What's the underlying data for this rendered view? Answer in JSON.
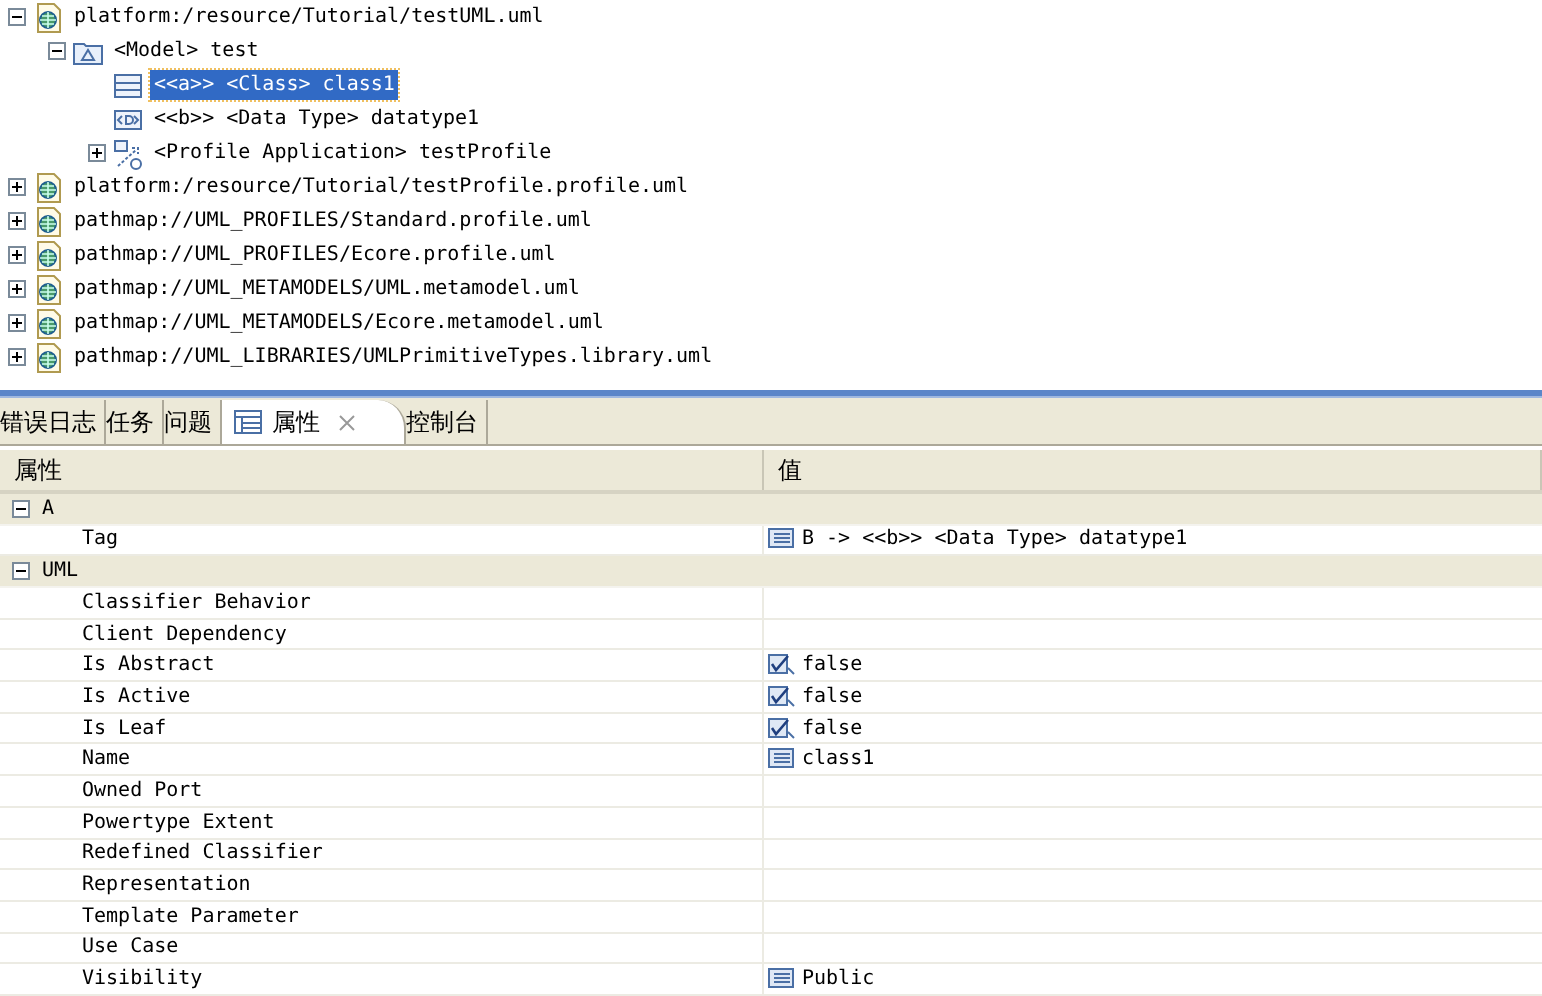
{
  "tree": [
    {
      "label": "platform:/resource/Tutorial/testUML.uml",
      "kind": "resource",
      "expanded": true,
      "selected": false,
      "children": [
        {
          "label": "<Model> test",
          "kind": "model",
          "expanded": true,
          "selected": false,
          "children": [
            {
              "label": "<<a>> <Class> class1",
              "kind": "class",
              "selected": true
            },
            {
              "label": "<<b>> <Data Type> datatype1",
              "kind": "datatype",
              "selected": false
            },
            {
              "label": "<Profile Application> testProfile",
              "kind": "profile",
              "expanded": false,
              "selected": false
            }
          ]
        }
      ]
    },
    {
      "label": "platform:/resource/Tutorial/testProfile.profile.uml",
      "kind": "resource",
      "expanded": false,
      "selected": false
    },
    {
      "label": "pathmap://UML_PROFILES/Standard.profile.uml",
      "kind": "resource",
      "expanded": false,
      "selected": false
    },
    {
      "label": "pathmap://UML_PROFILES/Ecore.profile.uml",
      "kind": "resource",
      "expanded": false,
      "selected": false
    },
    {
      "label": "pathmap://UML_METAMODELS/UML.metamodel.uml",
      "kind": "resource",
      "expanded": false,
      "selected": false
    },
    {
      "label": "pathmap://UML_METAMODELS/Ecore.metamodel.uml",
      "kind": "resource",
      "expanded": false,
      "selected": false
    },
    {
      "label": "pathmap://UML_LIBRARIES/UMLPrimitiveTypes.library.uml",
      "kind": "resource",
      "expanded": false,
      "selected": false
    }
  ],
  "tabs": [
    {
      "label": "错误日志",
      "selected": false
    },
    {
      "label": "任务",
      "selected": false
    },
    {
      "label": "问题",
      "selected": false
    },
    {
      "label": "属性",
      "selected": true
    },
    {
      "label": "控制台",
      "selected": false
    }
  ],
  "properties": {
    "columns": [
      "属性",
      "值"
    ],
    "groups": [
      {
        "label": "A",
        "expanded": true,
        "rows": [
          {
            "name": "Tag",
            "value": {
              "kind": "list",
              "text": "B -> <<b>> <Data Type> datatype1"
            }
          }
        ]
      },
      {
        "label": "UML",
        "expanded": true,
        "rows": [
          {
            "name": "Classifier Behavior"
          },
          {
            "name": "Client Dependency"
          },
          {
            "name": "Is Abstract",
            "value": {
              "kind": "bool",
              "text": "false"
            }
          },
          {
            "name": "Is Active",
            "value": {
              "kind": "bool",
              "text": "false"
            }
          },
          {
            "name": "Is Leaf",
            "value": {
              "kind": "bool",
              "text": "false"
            }
          },
          {
            "name": "Name",
            "value": {
              "kind": "list",
              "text": "class1"
            }
          },
          {
            "name": "Owned Port"
          },
          {
            "name": "Powertype Extent"
          },
          {
            "name": "Redefined Classifier"
          },
          {
            "name": "Representation"
          },
          {
            "name": "Template Parameter"
          },
          {
            "name": "Use Case"
          },
          {
            "name": "Visibility",
            "value": {
              "kind": "list",
              "text": "Public"
            }
          }
        ]
      }
    ]
  }
}
